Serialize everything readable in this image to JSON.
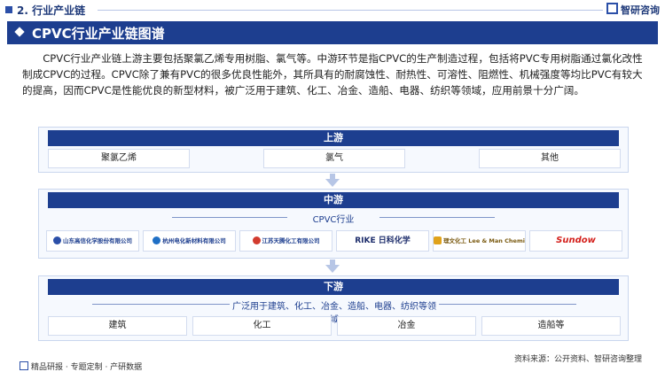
{
  "header": {
    "section": "2. 行业产业链",
    "brand": "智研咨询"
  },
  "banner": {
    "title": "CPVC行业产业链图谱"
  },
  "intro": "CPVC行业产业链上游主要包括聚氯乙烯专用树脂、氯气等。中游环节是指CPVC的生产制造过程，包括将PVC专用树脂通过氯化改性制成CPVC的过程。CPVC除了兼有PVC的很多优良性能外，其所具有的耐腐蚀性、耐热性、可溶性、阻燃性、机械强度等均比PVC有较大的提高，因而CPVC是性能优良的新型材料，被广泛用于建筑、化工、冶金、造船、电器、纺织等领域，应用前景十分广阔。",
  "upstream": {
    "title": "上游",
    "items": [
      "聚氯乙烯",
      "氯气",
      "其他"
    ]
  },
  "midstream": {
    "title": "中游",
    "label": "CPVC行业",
    "companies": [
      "山东高信化学股份有限公司",
      "杭州电化新材料有限公司",
      "江苏天腾化工有限公司",
      "RIKE 日科化学",
      "理文化工 Lee & Man Chemical",
      "Sundow"
    ]
  },
  "downstream": {
    "title": "下游",
    "label": "广泛用于建筑、化工、冶金、造船、电器、纺织等领域",
    "items": [
      "建筑",
      "化工",
      "冶金",
      "造船等"
    ]
  },
  "footer": {
    "left": "精品研报 · 专题定制 · 产研数据",
    "source": "资料来源：公开资料、智研咨询整理"
  },
  "colors": {
    "primary": "#1d3e8f",
    "panel_bg": "#f6f9fe",
    "arrow": "#b7c6e6"
  }
}
